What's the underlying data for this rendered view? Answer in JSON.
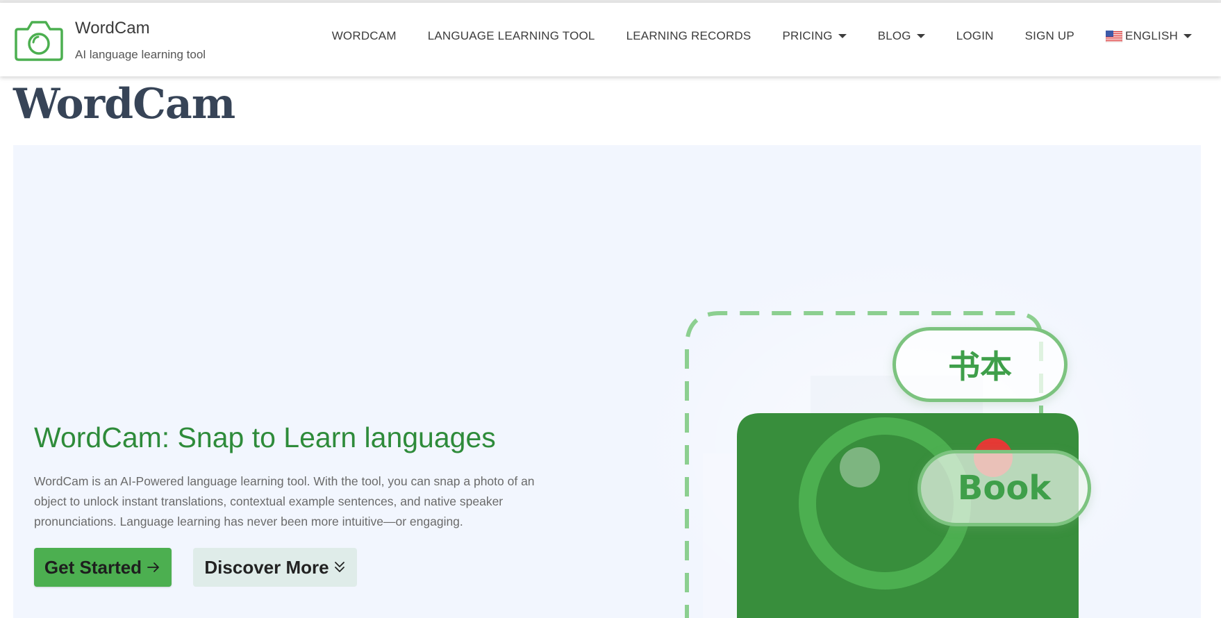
{
  "header": {
    "brand_name": "WordCam",
    "brand_tagline": "AI language learning tool",
    "logo_icon": "camera-icon",
    "nav": [
      {
        "label": "WORDCAM",
        "dropdown": false
      },
      {
        "label": "LANGUAGE LEARNING TOOL",
        "dropdown": false
      },
      {
        "label": "LEARNING RECORDS",
        "dropdown": false
      },
      {
        "label": "PRICING",
        "dropdown": true
      },
      {
        "label": "BLOG",
        "dropdown": true
      },
      {
        "label": "LOGIN",
        "dropdown": false
      },
      {
        "label": "SIGN UP",
        "dropdown": false
      },
      {
        "label": "ENGLISH",
        "dropdown": true,
        "icon": "us-flag-icon"
      }
    ]
  },
  "page": {
    "title": "WordCam"
  },
  "hero": {
    "heading": "WordCam: Snap to Learn languages",
    "description": "WordCam is an AI-Powered language learning tool. With the tool, you can snap a photo of an object to unlock instant translations, contextual example sentences, and native speaker pronunciations. Language learning has never been more intuitive—or engaging.",
    "primary_button": "Get Started",
    "primary_button_icon": "arrow-right-icon",
    "secondary_button": "Discover More",
    "secondary_button_icon": "double-chevron-down-icon",
    "illustration": {
      "label_chinese": "书本",
      "label_english": "Book"
    }
  },
  "colors": {
    "brand_green": "#4caf50",
    "heading_green": "#2e8b3a",
    "title_slate": "#374457",
    "hero_bg": "#f2f6fe",
    "camera_body": "#388e3c",
    "lens_ring": "#4caf50",
    "record_dot": "#e53935",
    "dashed_frame": "#8ccf90"
  }
}
